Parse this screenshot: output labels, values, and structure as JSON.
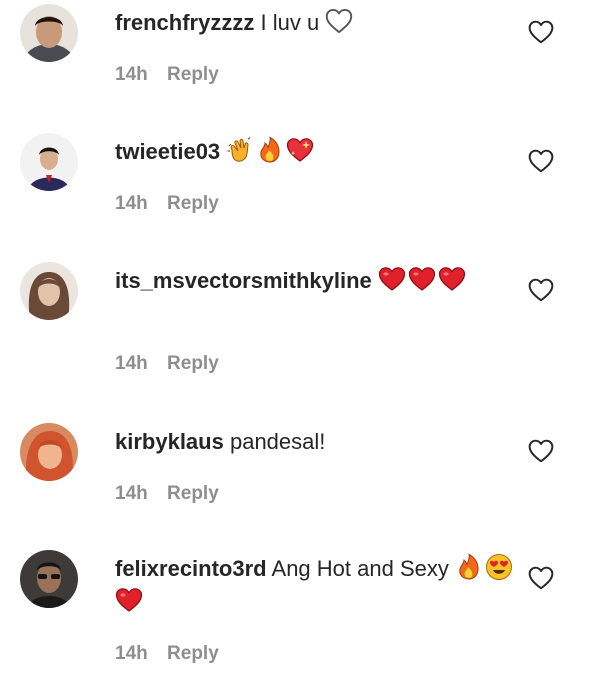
{
  "comments": [
    {
      "username": "frenchfryzzzz",
      "text": "I luv u",
      "time": "14h",
      "reply_label": "Reply",
      "avatar_color": "#c89a7c",
      "emojis": [
        "white-heart-outline"
      ]
    },
    {
      "username": "twieetie03",
      "text": "",
      "time": "14h",
      "reply_label": "Reply",
      "avatar_color": "#2a2a5a",
      "emojis": [
        "clapping-hands",
        "fire",
        "sparkling-heart"
      ]
    },
    {
      "username": "its_msvectorsmithkyline",
      "text": "",
      "time": "14h",
      "reply_label": "Reply",
      "avatar_color": "#d6b8a4",
      "emojis": [
        "red-heart",
        "red-heart",
        "red-heart"
      ]
    },
    {
      "username": "kirbyklaus",
      "text": "pandesal!",
      "time": "14h",
      "reply_label": "Reply",
      "avatar_color": "#e07a55",
      "emojis": []
    },
    {
      "username": "felixrecinto3rd",
      "text": "Ang Hot and Sexy",
      "time": "14h",
      "reply_label": "Reply",
      "avatar_color": "#5a4638",
      "emojis": [
        "fire",
        "smiling-face-with-heart-eyes",
        "red-heart"
      ]
    }
  ],
  "colors": {
    "text": "#262626",
    "meta": "#8e8e8e",
    "emoji_red": "#e0202a",
    "emoji_fire": "#f28a1a",
    "emoji_clap": "#f7b02a"
  }
}
